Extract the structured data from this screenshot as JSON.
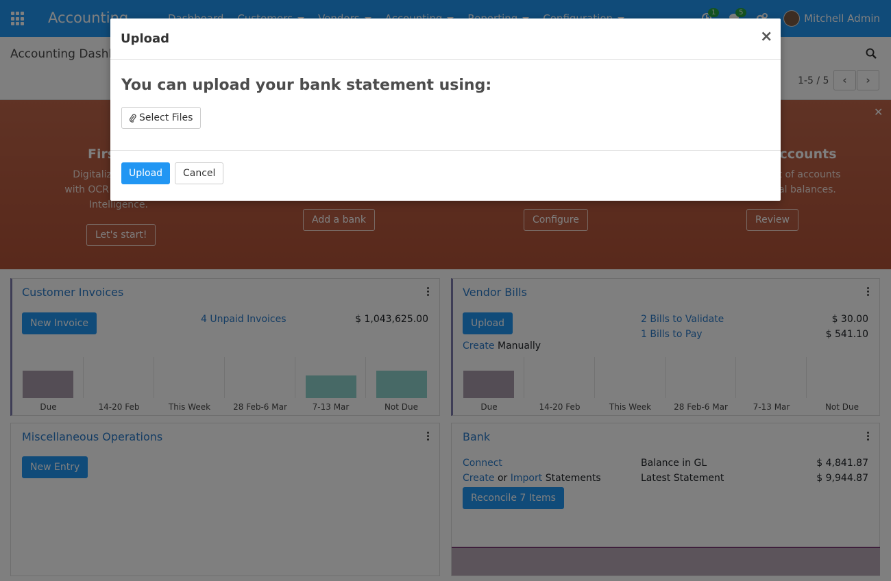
{
  "navbar": {
    "app_title": "Accounting",
    "menu": [
      "Dashboard",
      "Customers",
      "Vendors",
      "Accounting",
      "Reporting",
      "Configuration"
    ],
    "activity_count": "1",
    "messages_count": "5",
    "user_name": "Mitchell Admin"
  },
  "control_panel": {
    "breadcrumb": "Accounting Dashboard",
    "pager": "1-5 / 5"
  },
  "banner": {
    "steps": [
      {
        "title": "First Bill",
        "desc_lines": [
          "Digitalize your bills",
          "with OCR and Artificial",
          "Intelligence."
        ],
        "button": "Let's start!"
      },
      {
        "title": "",
        "desc_lines": [],
        "button": "Add a bank"
      },
      {
        "title": "",
        "desc_lines": [],
        "button": "Configure"
      },
      {
        "title": "Chart of Accounts",
        "desc_lines": [
          "Setup your chart of accounts",
          "and record initial balances."
        ],
        "button": "Review"
      }
    ]
  },
  "customer_invoices": {
    "title": "Customer Invoices",
    "new_button": "New Invoice",
    "unpaid_link": "4 Unpaid Invoices",
    "unpaid_amount": "$ 1,043,625.00",
    "graph_labels": [
      "Due",
      "14-20 Feb",
      "This Week",
      "28 Feb-6 Mar",
      "7-13 Mar",
      "Not Due"
    ]
  },
  "vendor_bills": {
    "title": "Vendor Bills",
    "upload_button": "Upload",
    "create_link": "Create",
    "manually_text": "Manually",
    "validate_link": "2 Bills to Validate",
    "validate_amount": "$ 30.00",
    "pay_link": "1 Bills to Pay",
    "pay_amount": "$ 541.10",
    "graph_labels": [
      "Due",
      "14-20 Feb",
      "This Week",
      "28 Feb-6 Mar",
      "7-13 Mar",
      "Not Due"
    ]
  },
  "misc_operations": {
    "title": "Miscellaneous Operations",
    "new_button": "New Entry"
  },
  "bank": {
    "title": "Bank",
    "connect_link": "Connect",
    "create_link": "Create",
    "or_text": "or",
    "import_link": "Import",
    "statements_text": "Statements",
    "balance_label": "Balance in GL",
    "balance_amount": "$ 4,841.87",
    "latest_label": "Latest Statement",
    "latest_amount": "$ 9,944.87",
    "reconcile_button": "Reconcile 7 Items"
  },
  "modal": {
    "title": "Upload",
    "body_title": "You can upload your bank statement using:",
    "select_files": "Select Files",
    "upload_button": "Upload",
    "cancel_button": "Cancel"
  },
  "colors": {
    "primary": "#2196f3",
    "banner": "#b7583e",
    "due_bar": "#a99aab",
    "notdue_bar": "#8fd3cd"
  }
}
